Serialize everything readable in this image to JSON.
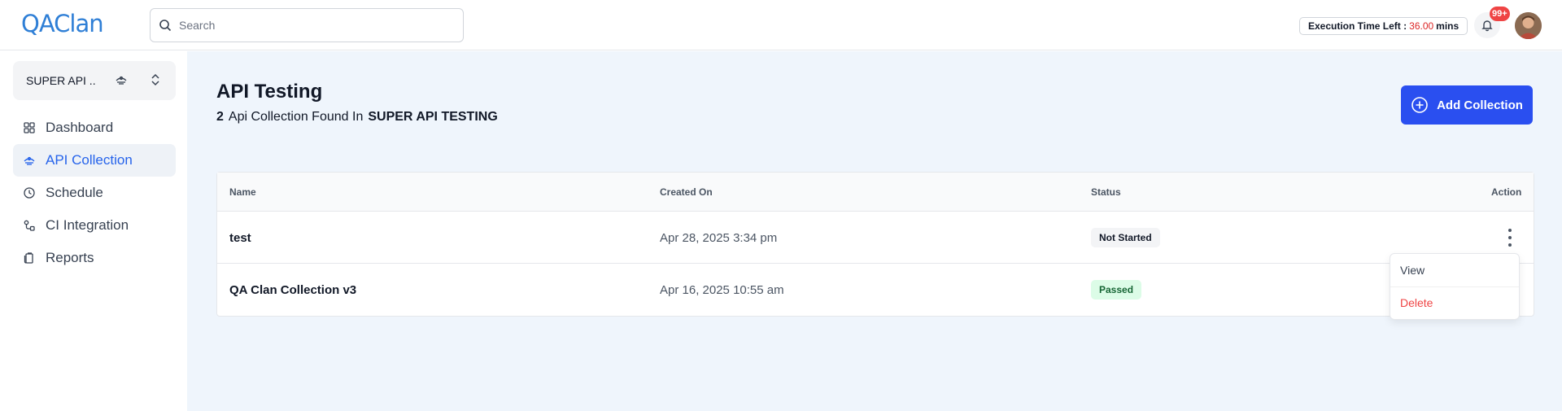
{
  "header": {
    "logo": "QAClan",
    "search_placeholder": "Search",
    "execution_label": "Execution Time Left :",
    "execution_value": "36.00",
    "execution_unit": "mins",
    "notification_count": "99+"
  },
  "sidebar": {
    "project_name": "SUPER API ..",
    "items": [
      {
        "label": "Dashboard",
        "icon": "grid-icon"
      },
      {
        "label": "API Collection",
        "icon": "api-icon"
      },
      {
        "label": "Schedule",
        "icon": "clock-icon"
      },
      {
        "label": "CI Integration",
        "icon": "integration-icon"
      },
      {
        "label": "Reports",
        "icon": "reports-icon"
      }
    ],
    "active": "API Collection"
  },
  "main": {
    "title": "API Testing",
    "count": "2",
    "found_text": "Api Collection Found In",
    "project": "SUPER API TESTING",
    "add_button": "Add Collection",
    "columns": [
      "Name",
      "Created On",
      "Status",
      "Action"
    ],
    "rows": [
      {
        "name": "test",
        "created": "Apr 28, 2025 3:34 pm",
        "status": "Not Started"
      },
      {
        "name": "QA Clan Collection v3",
        "created": "Apr 16, 2025 10:55 am",
        "status": "Passed"
      }
    ],
    "menu": {
      "view": "View",
      "delete": "Delete"
    }
  },
  "colors": {
    "accent": "#2a4ff0",
    "active_nav": "#2563eb",
    "danger": "#ef4444",
    "passed_bg": "#dcfce7"
  }
}
